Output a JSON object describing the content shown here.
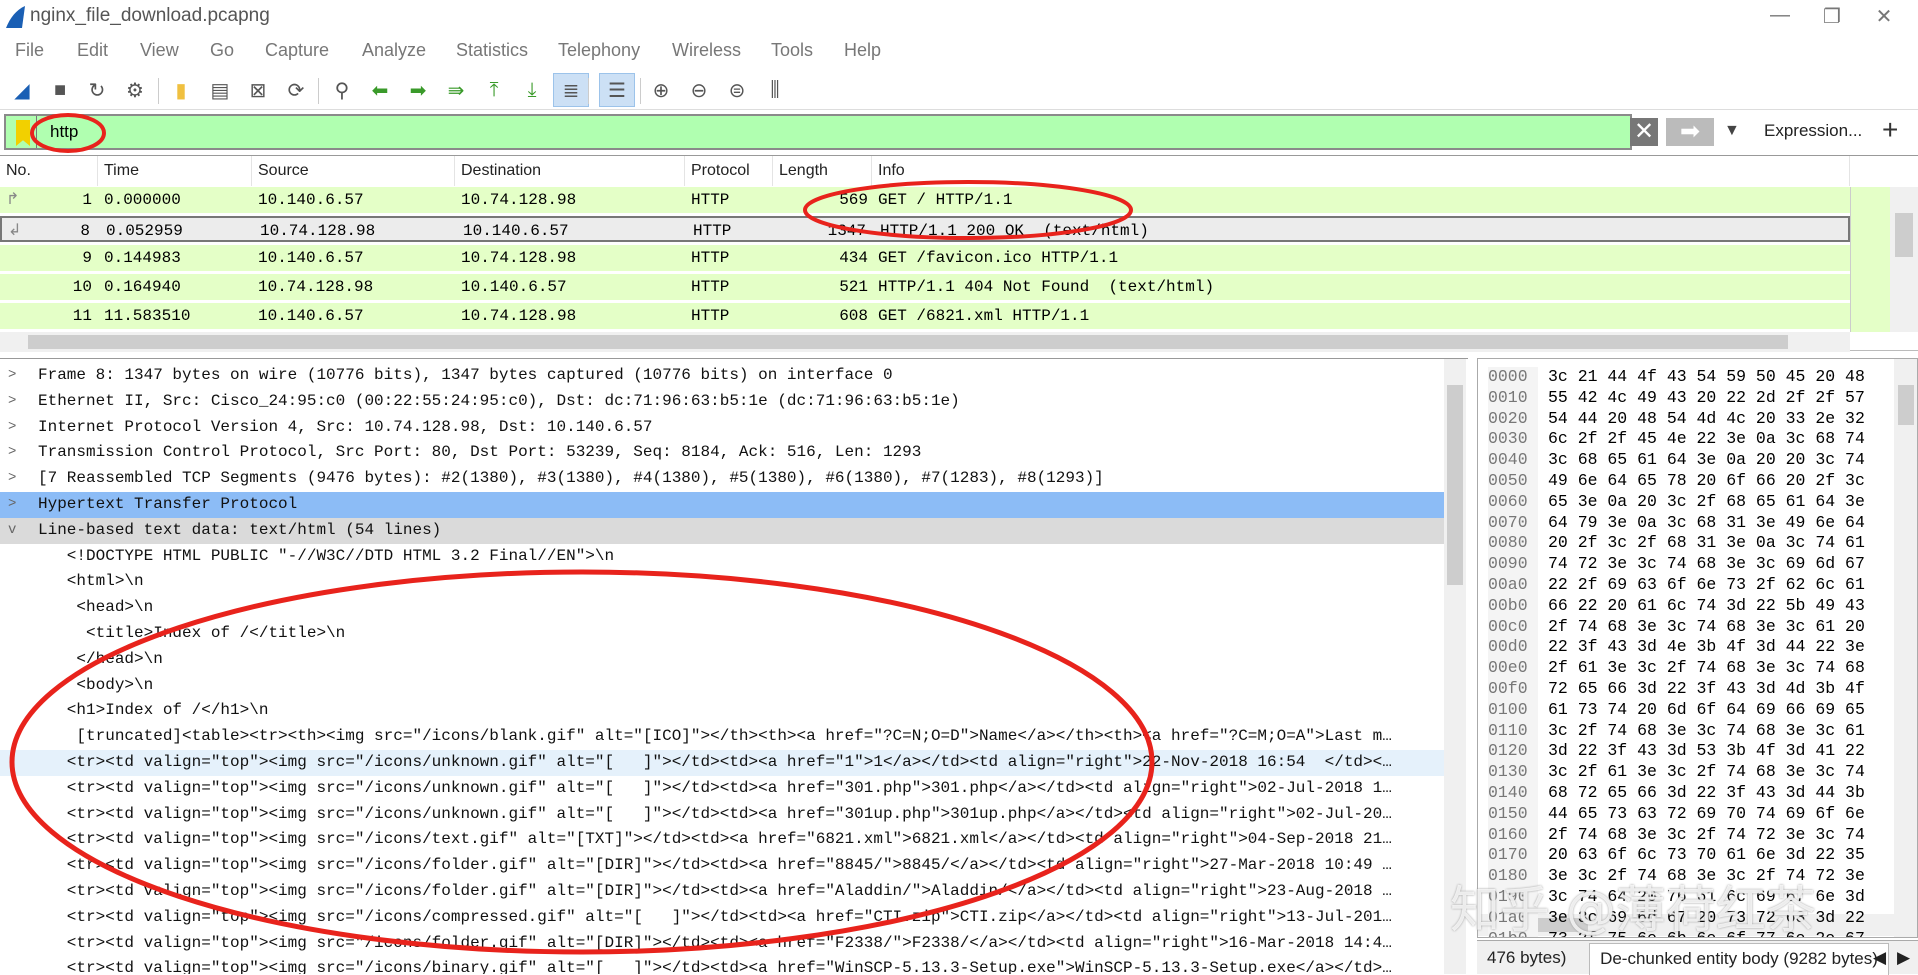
{
  "window": {
    "title": "nginx_file_download.pcapng",
    "controls": [
      "—",
      "❐",
      "✕"
    ]
  },
  "menu": [
    "File",
    "Edit",
    "View",
    "Go",
    "Capture",
    "Analyze",
    "Statistics",
    "Telephony",
    "Wireless",
    "Tools",
    "Help"
  ],
  "toolbar": [
    {
      "icon": "shark-fin-start-icon",
      "glyph": "◢"
    },
    {
      "icon": "stop-icon",
      "glyph": "■"
    },
    {
      "icon": "restart-icon",
      "glyph": "↻"
    },
    {
      "icon": "options-gear-icon",
      "glyph": "⚙"
    },
    {
      "icon": "open-folder-icon",
      "glyph": "▮"
    },
    {
      "icon": "file-icon",
      "glyph": "▤"
    },
    {
      "icon": "close-file-icon",
      "glyph": "⊠"
    },
    {
      "icon": "reload-icon",
      "glyph": "⟳"
    },
    {
      "icon": "find-icon",
      "glyph": "⚲"
    },
    {
      "icon": "back-arrow-icon",
      "glyph": "⬅"
    },
    {
      "icon": "forward-arrow-icon",
      "glyph": "➡"
    },
    {
      "icon": "go-to-packet-icon",
      "glyph": "⇛"
    },
    {
      "icon": "first-packet-icon",
      "glyph": "⤒"
    },
    {
      "icon": "last-packet-icon",
      "glyph": "⤓"
    },
    {
      "icon": "autoscroll-icon",
      "glyph": "≣",
      "active": true
    },
    {
      "icon": "colorize-icon",
      "glyph": "☰",
      "active": true
    },
    {
      "icon": "zoom-in-icon",
      "glyph": "⊕"
    },
    {
      "icon": "zoom-out-icon",
      "glyph": "⊖"
    },
    {
      "icon": "zoom-reset-icon",
      "glyph": "⊜"
    },
    {
      "icon": "resize-columns-icon",
      "glyph": "⫼"
    }
  ],
  "filter": {
    "value": "http",
    "expression_label": "Expression...",
    "clear_glyph": "✕",
    "apply_glyph": "➡",
    "dropdown_glyph": "▼",
    "add_glyph": "+",
    "bg_color": "#b0ffb0"
  },
  "packet_list": {
    "columns": [
      "No.",
      "Time",
      "Source",
      "Destination",
      "Protocol",
      "Length",
      "Info"
    ],
    "rows": [
      {
        "no": "1",
        "time": "0.000000",
        "src": "10.140.6.57",
        "dst": "10.74.128.98",
        "proto": "HTTP",
        "len": "569",
        "info": "GET / HTTP/1.1"
      },
      {
        "no": "8",
        "time": "0.052959",
        "src": "10.74.128.98",
        "dst": "10.140.6.57",
        "proto": "HTTP",
        "len": "1347",
        "info": "HTTP/1.1 200 OK  (text/html)",
        "selected": true
      },
      {
        "no": "9",
        "time": "0.144983",
        "src": "10.140.6.57",
        "dst": "10.74.128.98",
        "proto": "HTTP",
        "len": "434",
        "info": "GET /favicon.ico HTTP/1.1"
      },
      {
        "no": "10",
        "time": "0.164940",
        "src": "10.74.128.98",
        "dst": "10.140.6.57",
        "proto": "HTTP",
        "len": "521",
        "info": "HTTP/1.1 404 Not Found  (text/html)"
      },
      {
        "no": "11",
        "time": "11.583510",
        "src": "10.140.6.57",
        "dst": "10.74.128.98",
        "proto": "HTTP",
        "len": "608",
        "info": "GET /6821.xml HTTP/1.1"
      }
    ],
    "row_color": "#e4ffc7"
  },
  "details": [
    {
      "text": "Frame 8: 1347 bytes on wire (10776 bits), 1347 bytes captured (10776 bits) on interface 0",
      "chev": ">"
    },
    {
      "text": "Ethernet II, Src: Cisco_24:95:c0 (00:22:55:24:95:c0), Dst: dc:71:96:63:b5:1e (dc:71:96:63:b5:1e)",
      "chev": ">"
    },
    {
      "text": "Internet Protocol Version 4, Src: 10.74.128.98, Dst: 10.140.6.57",
      "chev": ">"
    },
    {
      "text": "Transmission Control Protocol, Src Port: 80, Dst Port: 53239, Seq: 8184, Ack: 516, Len: 1293",
      "chev": ">"
    },
    {
      "text": "[7 Reassembled TCP Segments (9476 bytes): #2(1380), #3(1380), #4(1380), #5(1380), #6(1380), #7(1283), #8(1293)]",
      "chev": ">"
    },
    {
      "text": "Hypertext Transfer Protocol",
      "chev": ">",
      "style": "sel"
    },
    {
      "text": "Line-based text data: text/html (54 lines)",
      "chev": "v",
      "style": "gray"
    },
    {
      "text": "   <!DOCTYPE HTML PUBLIC \"-//W3C//DTD HTML 3.2 Final//EN\">\\n"
    },
    {
      "text": "   <html>\\n"
    },
    {
      "text": "    <head>\\n"
    },
    {
      "text": "     <title>Index of /</title>\\n"
    },
    {
      "text": "    </head>\\n"
    },
    {
      "text": "    <body>\\n"
    },
    {
      "text": "   <h1>Index of /</h1>\\n"
    },
    {
      "text": "    [truncated]<table><tr><th><img src=\"/icons/blank.gif\" alt=\"[ICO]\"></th><th><a href=\"?C=N;O=D\">Name</a></th><th><a href=\"?C=M;O=A\">Last m…"
    },
    {
      "text": "   <tr><td valign=\"top\"><img src=\"/icons/unknown.gif\" alt=\"[   ]\"></td><td><a href=\"1\">1</a></td><td align=\"right\">22-Nov-2018 16:54  </td><…",
      "style": "hl"
    },
    {
      "text": "   <tr><td valign=\"top\"><img src=\"/icons/unknown.gif\" alt=\"[   ]\"></td><td><a href=\"301.php\">301.php</a></td><td align=\"right\">02-Jul-2018 1…"
    },
    {
      "text": "   <tr><td valign=\"top\"><img src=\"/icons/unknown.gif\" alt=\"[   ]\"></td><td><a href=\"301up.php\">301up.php</a></td><td align=\"right\">02-Jul-20…"
    },
    {
      "text": "   <tr><td valign=\"top\"><img src=\"/icons/text.gif\" alt=\"[TXT]\"></td><td><a href=\"6821.xml\">6821.xml</a></td><td align=\"right\">04-Sep-2018 21…"
    },
    {
      "text": "   <tr><td valign=\"top\"><img src=\"/icons/folder.gif\" alt=\"[DIR]\"></td><td><a href=\"8845/\">8845/</a></td><td align=\"right\">27-Mar-2018 10:49 …"
    },
    {
      "text": "   <tr><td valign=\"top\"><img src=\"/icons/folder.gif\" alt=\"[DIR]\"></td><td><a href=\"Aladdin/\">Aladdin/</a></td><td align=\"right\">23-Aug-2018 …"
    },
    {
      "text": "   <tr><td valign=\"top\"><img src=\"/icons/compressed.gif\" alt=\"[   ]\"></td><td><a href=\"CTI.zip\">CTI.zip</a></td><td align=\"right\">13-Jul-201…"
    },
    {
      "text": "   <tr><td valign=\"top\"><img src=\"/icons/folder.gif\" alt=\"[DIR]\"></td><td><a href=\"F2338/\">F2338/</a></td><td align=\"right\">16-Mar-2018 14:4…"
    },
    {
      "text": "   <tr><td valign=\"top\"><img src=\"/icons/binary.gif\" alt=\"[   ]\"></td><td><a href=\"WinSCP-5.13.3-Setup.exe\">WinSCP-5.13.3-Setup.exe</a></td>…"
    }
  ],
  "hex": [
    [
      "0000",
      "3c 21 44 4f 43 54 59 50 45 20 48"
    ],
    [
      "0010",
      "55 42 4c 49 43 20 22 2d 2f 2f 57"
    ],
    [
      "0020",
      "54 44 20 48 54 4d 4c 20 33 2e 32"
    ],
    [
      "0030",
      "6c 2f 2f 45 4e 22 3e 0a 3c 68 74"
    ],
    [
      "0040",
      "3c 68 65 61 64 3e 0a 20 20 3c 74"
    ],
    [
      "0050",
      "49 6e 64 65 78 20 6f 66 20 2f 3c"
    ],
    [
      "0060",
      "65 3e 0a 20 3c 2f 68 65 61 64 3e"
    ],
    [
      "0070",
      "64 79 3e 0a 3c 68 31 3e 49 6e 64"
    ],
    [
      "0080",
      "20 2f 3c 2f 68 31 3e 0a 3c 74 61"
    ],
    [
      "0090",
      "74 72 3e 3c 74 68 3e 3c 69 6d 67"
    ],
    [
      "00a0",
      "22 2f 69 63 6f 6e 73 2f 62 6c 61"
    ],
    [
      "00b0",
      "66 22 20 61 6c 74 3d 22 5b 49 43"
    ],
    [
      "00c0",
      "2f 74 68 3e 3c 74 68 3e 3c 61 20"
    ],
    [
      "00d0",
      "22 3f 43 3d 4e 3b 4f 3d 44 22 3e"
    ],
    [
      "00e0",
      "2f 61 3e 3c 2f 74 68 3e 3c 74 68"
    ],
    [
      "00f0",
      "72 65 66 3d 22 3f 43 3d 4d 3b 4f"
    ],
    [
      "0100",
      "61 73 74 20 6d 6f 64 69 66 69 65"
    ],
    [
      "0110",
      "3c 2f 74 68 3e 3c 74 68 3e 3c 61"
    ],
    [
      "0120",
      "3d 22 3f 43 3d 53 3b 4f 3d 41 22"
    ],
    [
      "0130",
      "3c 2f 61 3e 3c 2f 74 68 3e 3c 74"
    ],
    [
      "0140",
      "68 72 65 66 3d 22 3f 43 3d 44 3b"
    ],
    [
      "0150",
      "44 65 73 63 72 69 70 74 69 6f 6e"
    ],
    [
      "0160",
      "2f 74 68 3e 3c 2f 74 72 3e 3c 74"
    ],
    [
      "0170",
      "20 63 6f 6c 73 70 61 6e 3d 22 35"
    ],
    [
      "0180",
      "3e 3c 2f 74 68 3e 3c 2f 74 72 3e"
    ],
    [
      "0190",
      "3c 74 64 20 76 61 6c 69 67 6e 3d"
    ],
    [
      "01a0",
      "3e 3c 69 6d 67 20 73 72 63 3d 22"
    ],
    [
      "01b0",
      "73 2f 75 6e 6b 6e 6f 77 6e 2e 67"
    ]
  ],
  "bottom_tabs": [
    {
      "label": "476 bytes)"
    },
    {
      "label": "De-chunked entity body (9282 bytes)",
      "active": true
    }
  ],
  "bottom_nav": [
    "◀",
    "▶"
  ],
  "watermark": "知乎 @薄荷红茶",
  "annotation_color": "#e8231c"
}
